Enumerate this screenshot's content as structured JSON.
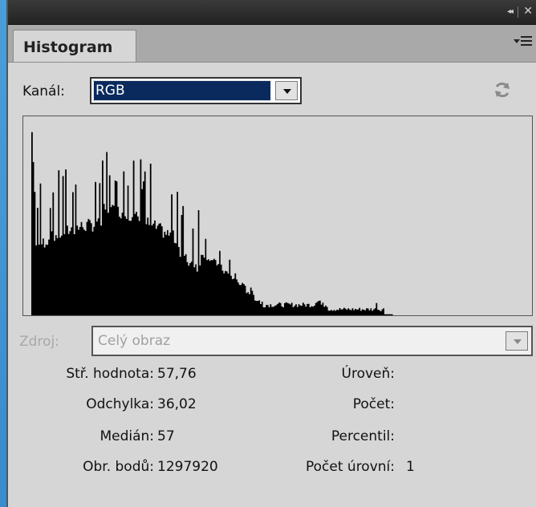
{
  "titlebar": {
    "collapse_icon": "double-chevron-left-icon",
    "close_icon": "close-icon"
  },
  "tab": {
    "label": "Histogram"
  },
  "panel_menu_icon": "panel-menu-icon",
  "channel": {
    "label": "Kanál:",
    "value": "RGB"
  },
  "refresh_icon": "refresh-icon",
  "source": {
    "label": "Zdroj:",
    "value": "Celý obraz"
  },
  "stats_left": [
    {
      "label": "Stř. hodnota:",
      "value": "57,76"
    },
    {
      "label": "Odchylka:",
      "value": "36,02"
    },
    {
      "label": "Medián:",
      "value": "57"
    },
    {
      "label": "Obr. bodů:",
      "value": "1297920"
    }
  ],
  "stats_right": [
    {
      "label": "Úroveň:",
      "value": ""
    },
    {
      "label": "Počet:",
      "value": ""
    },
    {
      "label": "Percentil:",
      "value": ""
    },
    {
      "label": "Počet úrovní:",
      "value": "1"
    }
  ],
  "colors": {
    "panel_bg": "#d6d6d6",
    "titlebar_bg": "#2b2b2b",
    "selection_bg": "#0a2a5e",
    "histogram_fill": "#000000"
  }
}
